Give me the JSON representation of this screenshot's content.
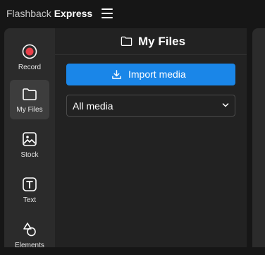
{
  "app": {
    "brand_part1": "Flashback",
    "brand_part2": "Express"
  },
  "sidebar": {
    "items": [
      {
        "label": "Record",
        "icon": "record-icon"
      },
      {
        "label": "My Files",
        "icon": "folder-icon",
        "active": true
      },
      {
        "label": "Stock",
        "icon": "image-icon"
      },
      {
        "label": "Text",
        "icon": "text-icon"
      },
      {
        "label": "Elements",
        "icon": "shapes-icon"
      }
    ]
  },
  "panel": {
    "title": "My Files",
    "import_label": "Import media",
    "filter": {
      "selected": "All media"
    }
  },
  "colors": {
    "accent": "#1a86e8",
    "record": "#e8404a",
    "rail": "#2b2b2b",
    "panel": "#222222",
    "background": "#161616"
  }
}
